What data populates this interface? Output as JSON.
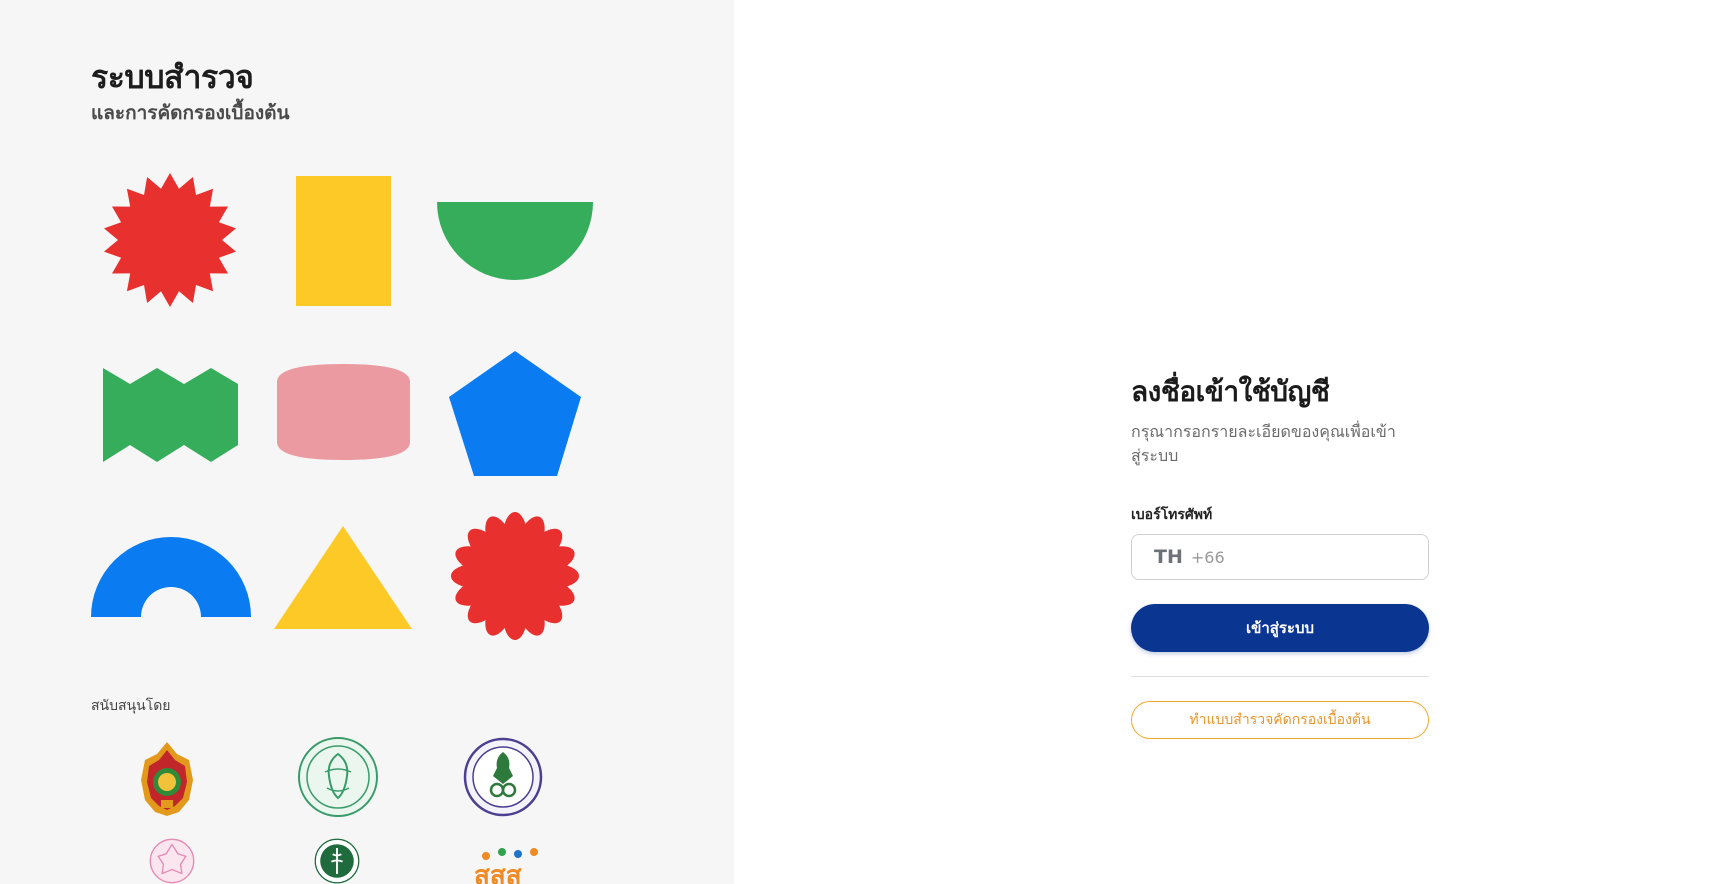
{
  "brand": {
    "title": "ระบบสำรวจ",
    "subtitle": "และการคัดกรองเบื้องต้น"
  },
  "shape_colors": {
    "red": "#e8302f",
    "yellow": "#fdc926",
    "green": "#35ad5b",
    "pink": "#ec9aa2",
    "blue": "#0a7bf0"
  },
  "support": {
    "label": "สนับสนุนโดย",
    "logos": [
      {
        "name": "ministry-of-education-logo",
        "text": ""
      },
      {
        "name": "green-seal-logo",
        "text": ""
      },
      {
        "name": "purple-seal-logo",
        "text": ""
      },
      {
        "name": "pink-seal-logo",
        "text": ""
      },
      {
        "name": "ministry-of-public-health-logo",
        "text": ""
      },
      {
        "name": "thaihealth-logo",
        "text": "สสส"
      }
    ]
  },
  "login": {
    "title": "ลงชื่อเข้าใช้บัญชี",
    "subtitle": "กรุณากรอกรายละเอียดของคุณเพื่อเข้าสู่ระบบ",
    "phone_label": "เบอร์โทรศัพท์",
    "country_code": "TH",
    "dial_code": "+66",
    "phone_value": "",
    "phone_placeholder": "",
    "submit_label": "เข้าสู่ระบบ",
    "survey_label": "ทำแบบสำรวจคัดกรองเบื้องต้น",
    "primary_color": "#0a3691",
    "accent_color": "#f0a830"
  }
}
